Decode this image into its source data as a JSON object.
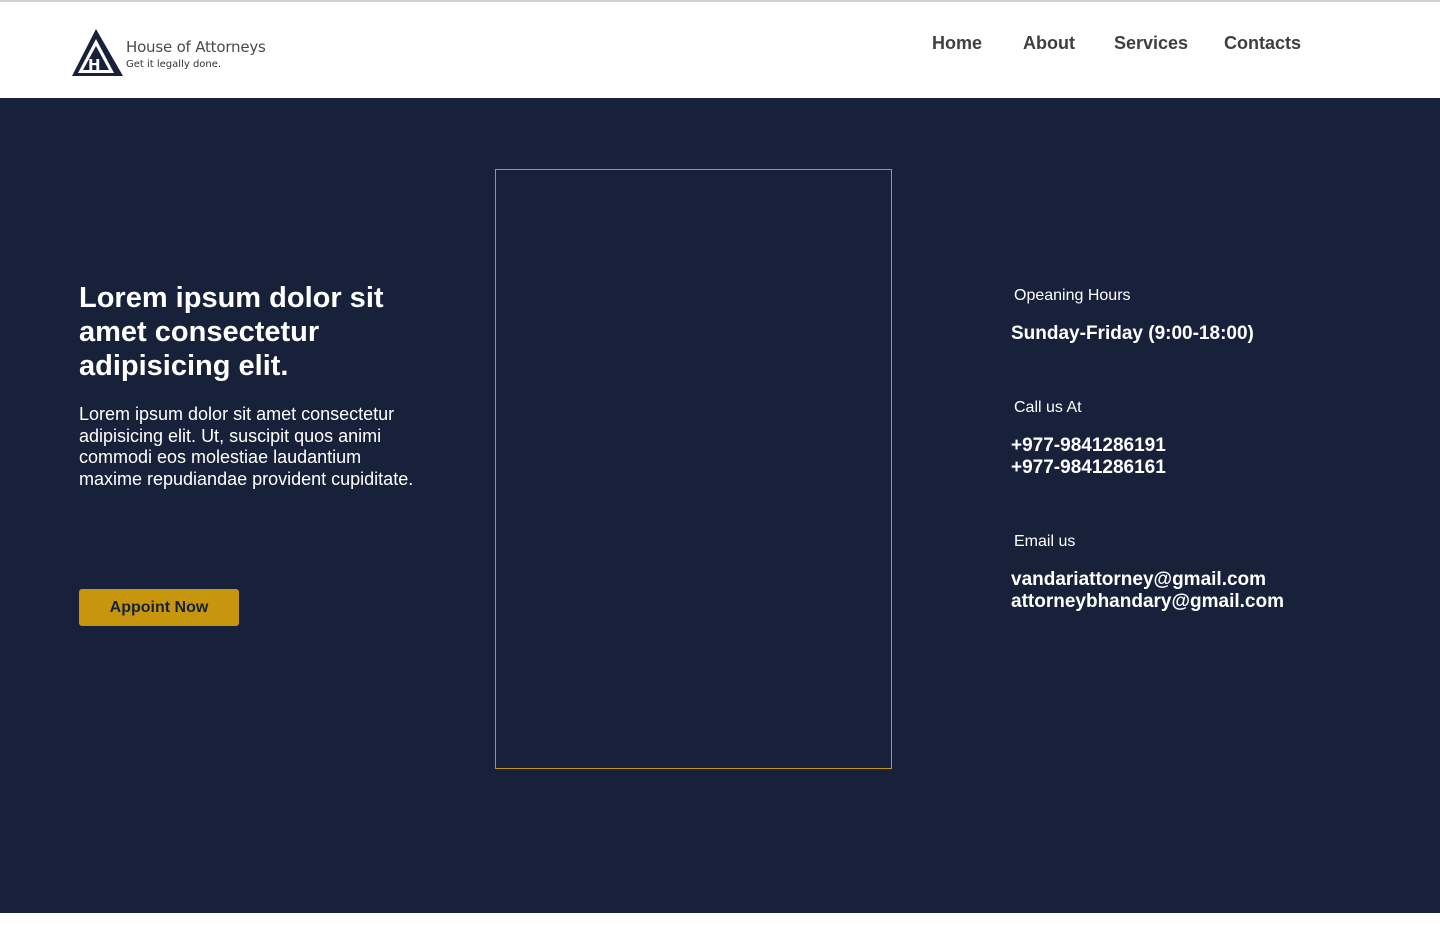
{
  "brand": {
    "name": "House of Attorneys",
    "tagline": "Get it legally done.",
    "logo_letter": "H"
  },
  "nav": {
    "items": [
      "Home",
      "About",
      "Services",
      "Contacts"
    ]
  },
  "hero": {
    "title": "Lorem ipsum dolor sit amet consectetur adipisicing elit.",
    "text": "Lorem ipsum dolor sit amet consectetur adipisicing elit. Ut, suscipit quos animi commodi eos molestiae laudantium maxime repudiandae provident cupiditate.",
    "button_label": "Appoint Now"
  },
  "contact": {
    "hours_label": "Opeaning Hours",
    "hours_value": "Sunday-Friday (9:00-18:00)",
    "call_label": "Call us At",
    "phones": [
      "+977-9841286191",
      "+977-9841286161"
    ],
    "email_label": "Email us",
    "emails": [
      "vandariattorney@gmail.com",
      "attorneybhandary@gmail.com"
    ]
  },
  "colors": {
    "background": "#17223a",
    "accent": "#c8960c",
    "nav_text": "#3f3f3f"
  }
}
